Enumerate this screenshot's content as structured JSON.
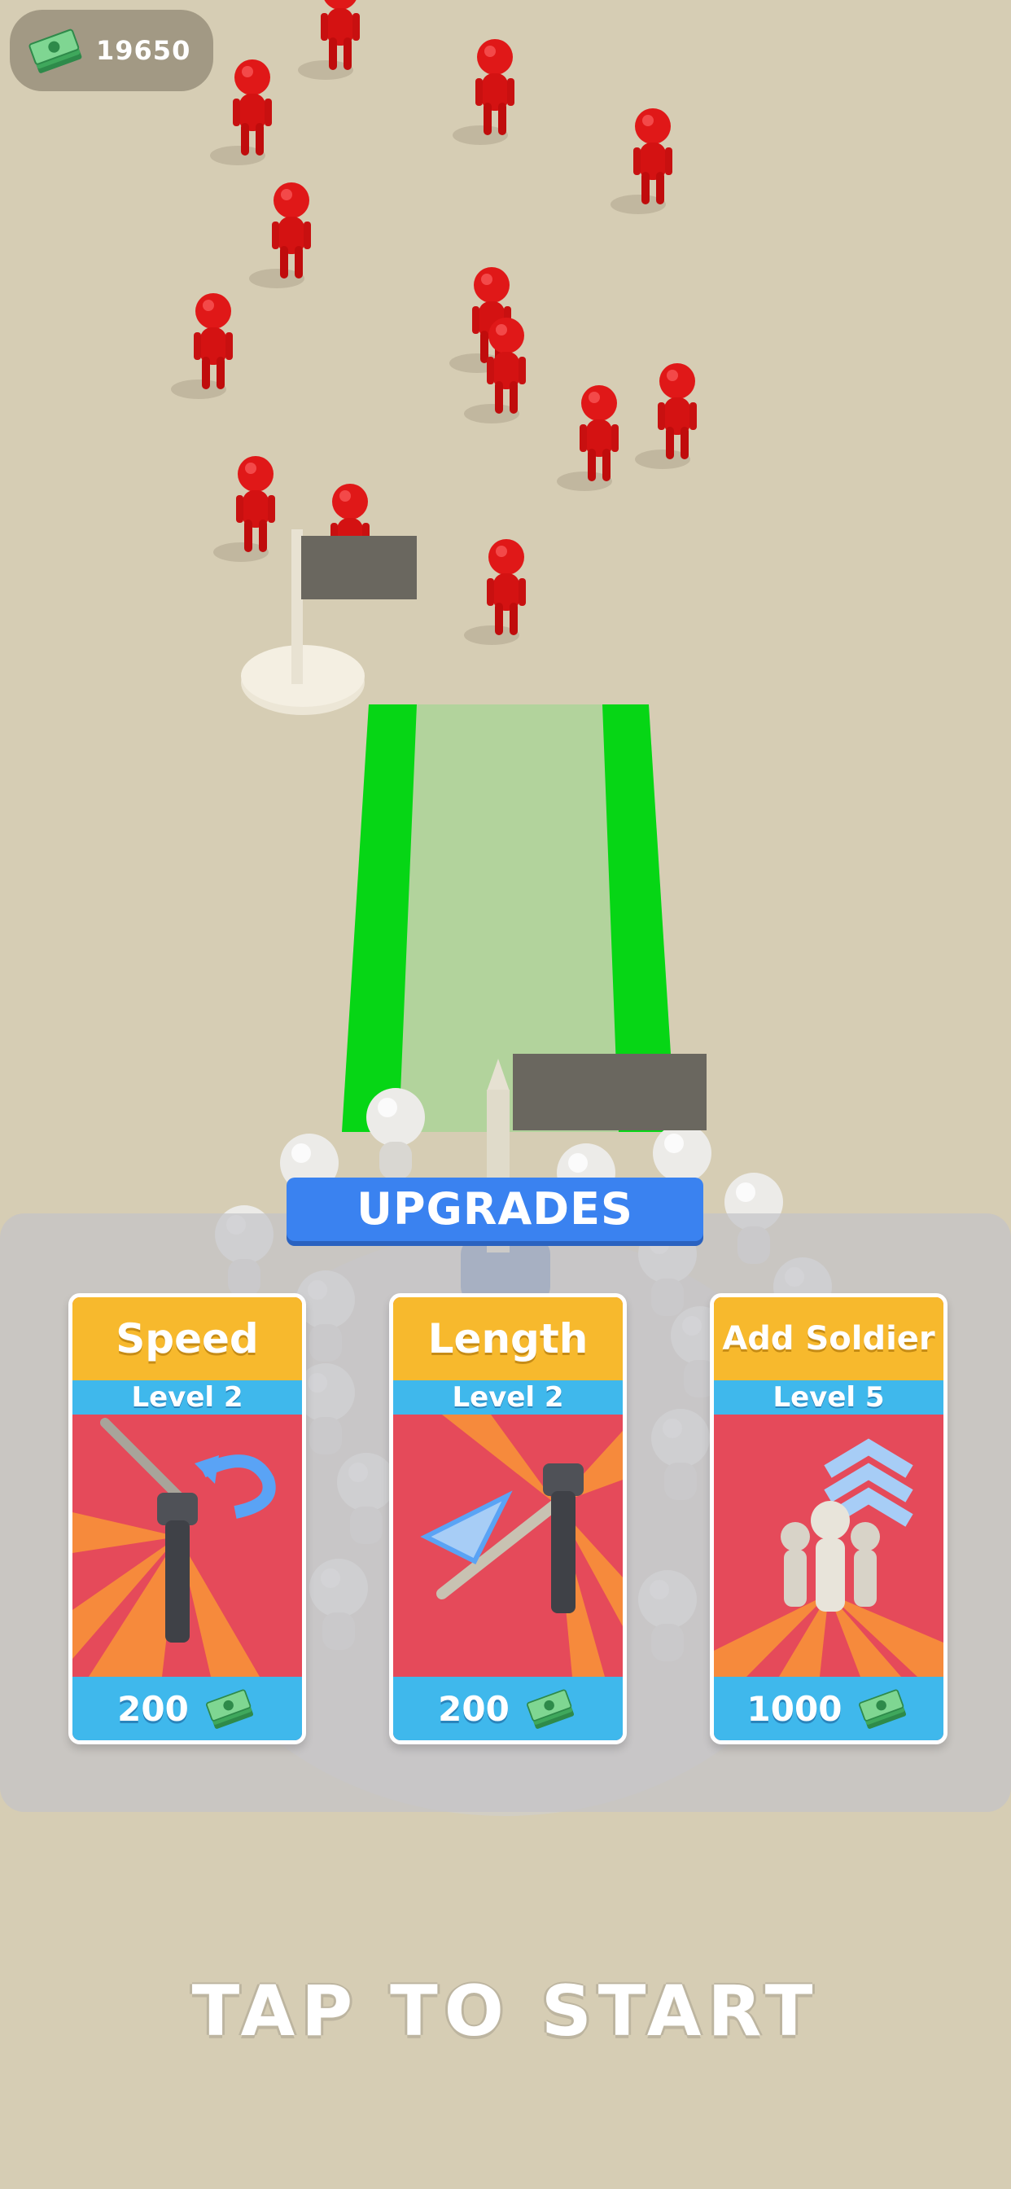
{
  "hud": {
    "currency_amount": "19650",
    "currency_icon": "cash-stack-icon"
  },
  "upgrades": {
    "title": "UPGRADES",
    "cards": [
      {
        "name": "Speed",
        "level": "Level 2",
        "cost": "200",
        "icon": "rotating-lever-icon"
      },
      {
        "name": "Length",
        "level": "Level 2",
        "cost": "200",
        "icon": "extending-spear-icon"
      },
      {
        "name": "Add Soldier",
        "level": "Level 5",
        "cost": "1000",
        "icon": "soldier-group-icon"
      }
    ]
  },
  "start_prompt": "TAP TO START",
  "colors": {
    "ground": "#d6cdb4",
    "enemy": "#e01818",
    "soldier": "#e8e6e2",
    "card_name_bg": "#f7b92d",
    "card_level_bg": "#3fb8ec",
    "card_art_bg": "#e54a5a",
    "upgrades_title_bg": "#3a82f0",
    "path_green": "#06d615"
  }
}
